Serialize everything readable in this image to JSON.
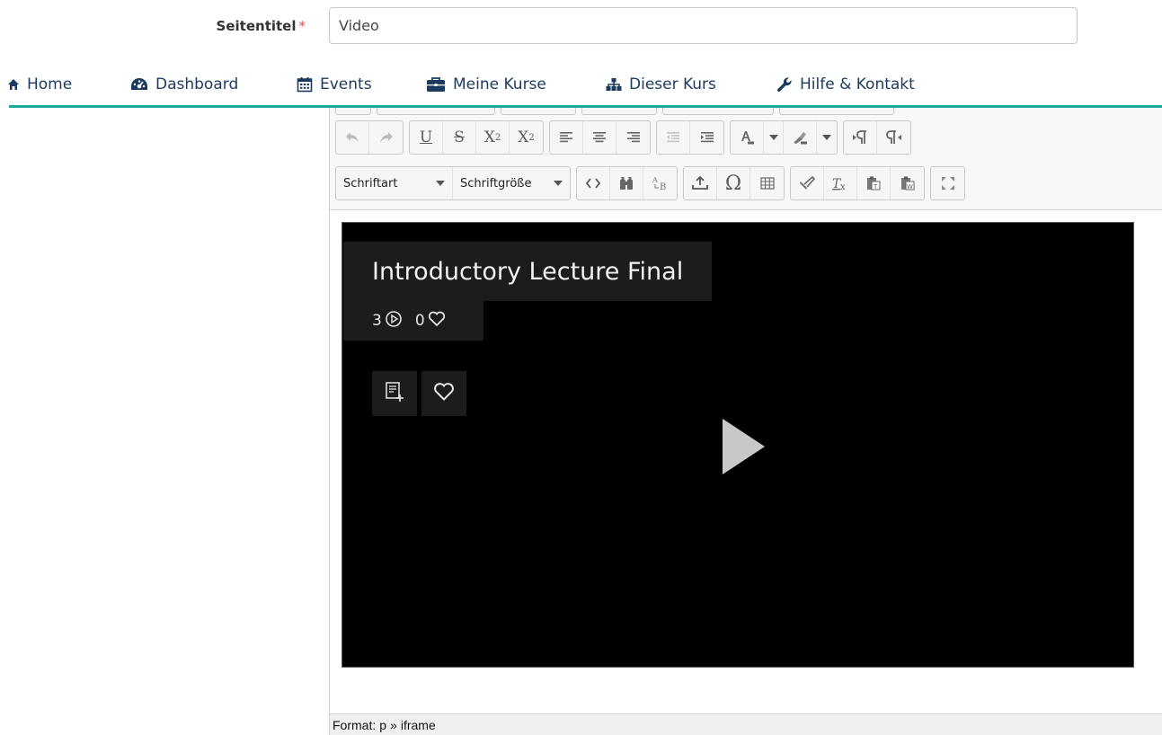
{
  "form": {
    "title_label": "Seitentitel",
    "required_mark": "*",
    "title_value": "Video"
  },
  "nav": {
    "accent_color": "#1aa89a",
    "items": [
      {
        "label": "Home",
        "icon": "home-icon"
      },
      {
        "label": "Dashboard",
        "icon": "dashboard-icon"
      },
      {
        "label": "Events",
        "icon": "calendar-icon"
      },
      {
        "label": "Meine Kurse",
        "icon": "briefcase-icon"
      },
      {
        "label": "Dieser Kurs",
        "icon": "sitemap-icon"
      },
      {
        "label": "Hilfe & Kontakt",
        "icon": "wrench-icon"
      }
    ]
  },
  "editor": {
    "toolbar": {
      "font_combo": "Schriftart",
      "size_combo": "Schriftgröße",
      "subscript": "X",
      "superscript": "X",
      "underline": "U",
      "strike": "S",
      "omega": "Ω"
    },
    "video": {
      "title": "Introductory Lecture Final",
      "plays": "3",
      "likes": "0"
    },
    "statusbar": {
      "format_label": "Format:",
      "path_p": "p",
      "separator": "»",
      "path_iframe": "iframe"
    }
  }
}
